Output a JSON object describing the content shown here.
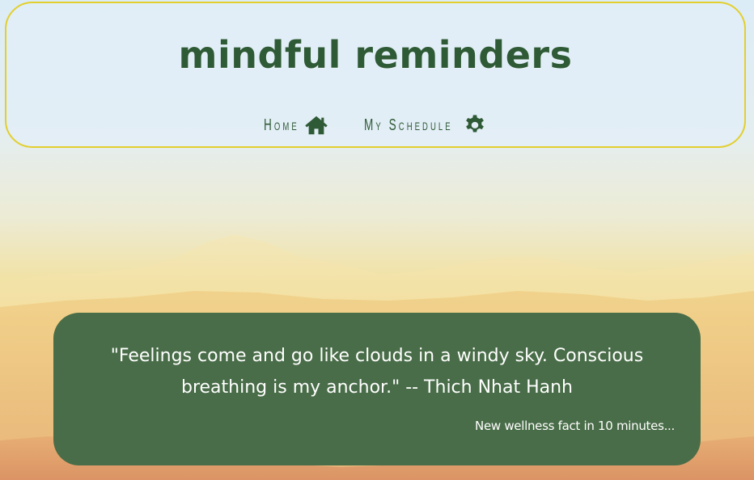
{
  "header": {
    "title": "mindful reminders",
    "nav": [
      {
        "label": "Home",
        "icon": "home-icon"
      },
      {
        "label": "My Schedule",
        "icon": "gear-icon"
      }
    ]
  },
  "quote": {
    "text": "\"Feelings come and go like clouds in a windy sky. Conscious breathing is my anchor.\" -- Thich Nhat Hanh",
    "timer": "New wellness fact in 10 minutes..."
  },
  "colors": {
    "brand_green": "#2f5a36",
    "card_green": "#496d48",
    "header_border": "#e3cf2c"
  }
}
